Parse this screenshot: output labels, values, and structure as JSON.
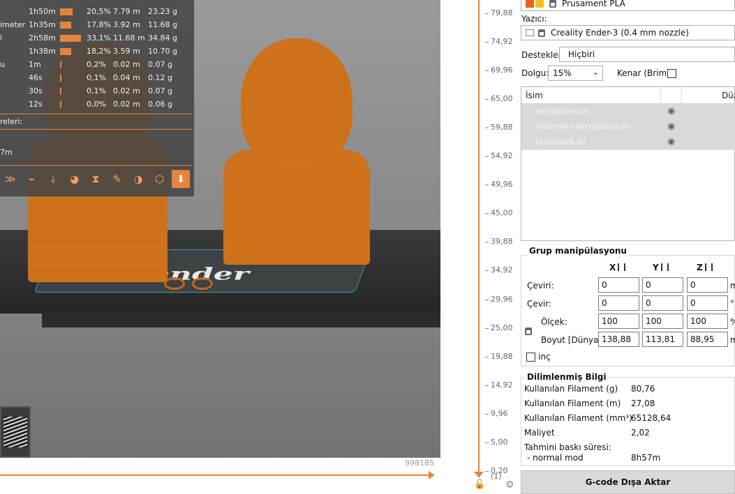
{
  "stats": {
    "rows": [
      {
        "name": "",
        "time": "1h50m",
        "pct": "20,5%",
        "len": "7.79 m",
        "wt": "23.23 g",
        "fill": 0.205
      },
      {
        "name": "imeter",
        "time": "1h35m",
        "pct": "17,8%",
        "len": "3.92 m",
        "wt": "11.68 g",
        "fill": 0.178
      },
      {
        "name": "l",
        "time": "2h58m",
        "pct": "33,1%",
        "len": "11.68 m",
        "wt": "34.84 g",
        "fill": 0.331
      },
      {
        "name": "",
        "time": "1h38m",
        "pct": "18,2%",
        "len": "3.59 m",
        "wt": "10.70 g",
        "fill": 0.182
      },
      {
        "name": "u",
        "time": "1m",
        "pct": "0,2%",
        "len": "0.02 m",
        "wt": "0.07 g",
        "fill": 0.002
      },
      {
        "name": "",
        "time": "46s",
        "pct": "0,1%",
        "len": "0.04 m",
        "wt": "0.12 g",
        "fill": 0.001
      },
      {
        "name": "",
        "time": "30s",
        "pct": "0,1%",
        "len": "0.02 m",
        "wt": "0.07 g",
        "fill": 0.001
      },
      {
        "name": "",
        "time": "12s",
        "pct": "0,0%",
        "len": "0.02 m",
        "wt": "0.06 g",
        "fill": 0.0
      }
    ],
    "partial_label": "releri:",
    "partial_time": "7m"
  },
  "legend_icons": [
    "layers-down-icon",
    "retract-icon",
    "seam-icon",
    "color-change-icon",
    "pause-icon",
    "custom-gcode-icon",
    "shells-icon",
    "cube-icon",
    "tool-marker-icon"
  ],
  "hslider_value": "998185",
  "vslider": {
    "ticks": [
      "79,88",
      "74,92",
      "69,96",
      "65,00",
      "59,88",
      "54,92",
      "49,96",
      "45,00",
      "39,88",
      "34,92",
      "29,96",
      "25,00",
      "19,88",
      "14,92",
      "9,96",
      "5,00",
      "0,20"
    ],
    "bottom_label": "(1)"
  },
  "panel": {
    "filament": "Prusament PLA",
    "printer_label": "Yazıcı:",
    "printer": "Creality Ender-3 (0.4 mm nozzle)",
    "supports_label": "Destekler:",
    "supports_value": "Hiçbiri",
    "infill_label": "Dolgu:",
    "infill_value": "15%",
    "brim_label": "Kenar (Brim):",
    "list_header_name": "İsim",
    "list_header_extra": "Düz",
    "objects": [
      "eyeglasses.stl",
      "tyutchev+eyeglasses.stl",
      "tyutchev6.stl"
    ],
    "group_title": "Grup manipülasyonu",
    "axes": [
      "X",
      "Y",
      "Z"
    ],
    "rows": [
      {
        "label": "Çeviri:",
        "values": [
          "0",
          "0",
          "0"
        ],
        "unit": "m"
      },
      {
        "label": "Çevir:",
        "values": [
          "0",
          "0",
          "0"
        ],
        "unit": "°"
      },
      {
        "label": "Ölçek:",
        "values": [
          "100",
          "100",
          "100"
        ],
        "unit": "%"
      },
      {
        "label": "Boyut [Dünya]:",
        "values": [
          "138,88",
          "113,81",
          "88,95"
        ],
        "unit": "m"
      }
    ],
    "inch_label": "inç",
    "sliced_title": "Dilimlenmiş Bilgi",
    "sliced": [
      {
        "k": "Kullanılan Filament (g)",
        "v": "80,76"
      },
      {
        "k": "Kullanılan Filament (m)",
        "v": "27,08"
      },
      {
        "k": "Kullanılan Filament (mm³)",
        "v": "65128,64"
      },
      {
        "k": "Maliyet",
        "v": "2,02"
      },
      {
        "k": "Tahmini baskı süresi:",
        "v": ""
      },
      {
        "k": " - normal mod",
        "v": "8h57m"
      }
    ],
    "export_label": "G-code Dışa Aktar"
  },
  "colors": {
    "accent": "#e8833a",
    "filament_swatch_1": "#f25c1c",
    "filament_swatch_2": "#f7c21a"
  }
}
